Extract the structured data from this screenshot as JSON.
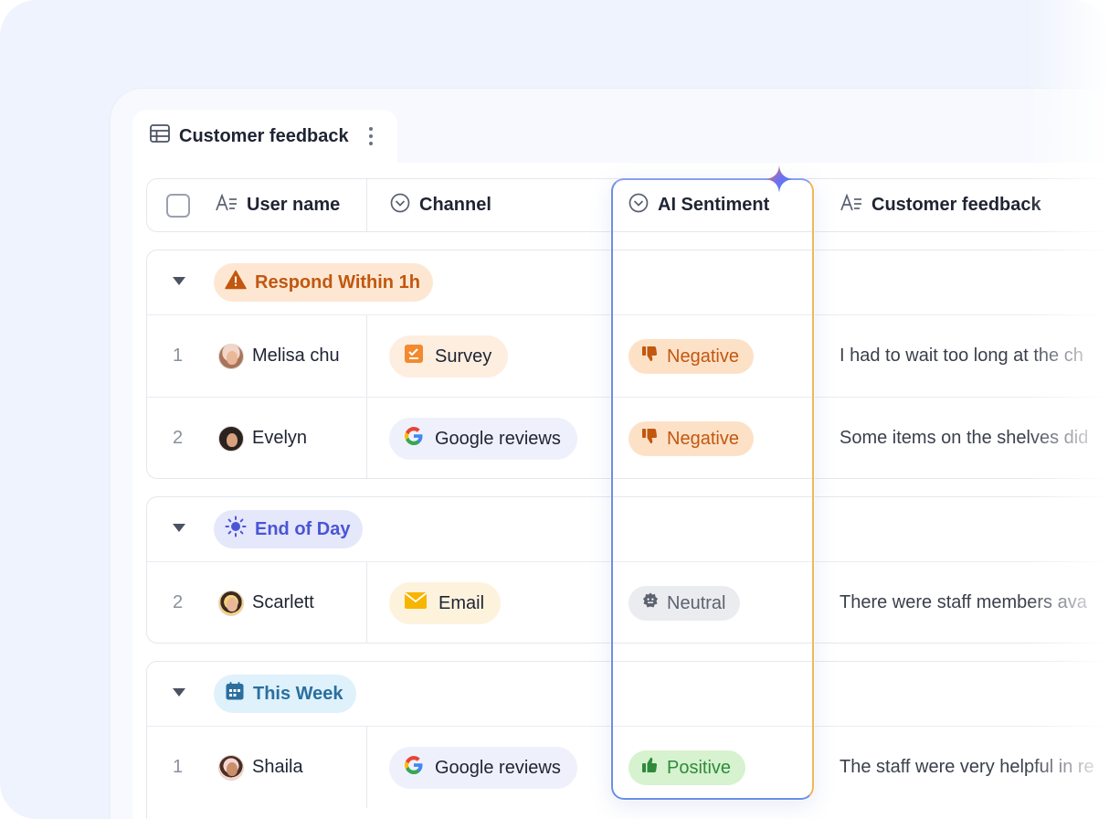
{
  "view": {
    "title": "Customer feedback",
    "icon": "table-icon",
    "menu_icon": "more-vertical-icon"
  },
  "columns": [
    {
      "label": "User name",
      "icon": "text-field-icon"
    },
    {
      "label": "Channel",
      "icon": "dropdown-circle-icon"
    },
    {
      "label": "AI Sentiment",
      "icon": "dropdown-circle-icon",
      "highlighted": true,
      "accent_icon": "ai-sparkle-icon"
    },
    {
      "label": "Customer feedback",
      "icon": "text-field-icon"
    }
  ],
  "groups": [
    {
      "label": "Respond Within 1h",
      "icon": "warning-triangle-icon",
      "color": "#c2570f",
      "background": "#fde7d3",
      "rows": [
        {
          "num": "1",
          "user": "Melisa chu",
          "channel": "Survey",
          "channel_icon": "survey-checkbox-icon",
          "sentiment": "Negative",
          "sentiment_icon": "thumbs-down-icon",
          "feedback": "I had to wait too long at the ch"
        },
        {
          "num": "2",
          "user": "Evelyn",
          "channel": "Google reviews",
          "channel_icon": "google-icon",
          "sentiment": "Negative",
          "sentiment_icon": "thumbs-down-icon",
          "feedback": "Some items on the shelves did"
        }
      ]
    },
    {
      "label": "End of Day",
      "icon": "sun-icon",
      "color": "#4a55d6",
      "background": "#e5e7fb",
      "rows": [
        {
          "num": "2",
          "user": "Scarlett",
          "channel": "Email",
          "channel_icon": "envelope-icon",
          "sentiment": "Neutral",
          "sentiment_icon": "neutral-face-icon",
          "feedback": "There were staff members ava"
        }
      ]
    },
    {
      "label": "This Week",
      "icon": "calendar-icon",
      "color": "#2b6f9e",
      "background": "#dff1fb",
      "rows": [
        {
          "num": "1",
          "user": "Shaila",
          "channel": "Google reviews",
          "channel_icon": "google-icon",
          "sentiment": "Positive",
          "sentiment_icon": "thumbs-up-icon",
          "feedback": "The staff were very helpful in re"
        }
      ]
    }
  ],
  "colors": {
    "negative_bg": "#fde1c7",
    "negative_fg": "#c2570f",
    "neutral_bg": "#ebecef",
    "neutral_fg": "#5d6270",
    "positive_bg": "#d6f2cf",
    "positive_fg": "#2f8a3c",
    "survey_chip_bg": "#fdeee0",
    "google_chip_bg": "#eef1fb",
    "email_chip_bg": "#fdf3dd",
    "ai_border": "#6a8fe8"
  }
}
